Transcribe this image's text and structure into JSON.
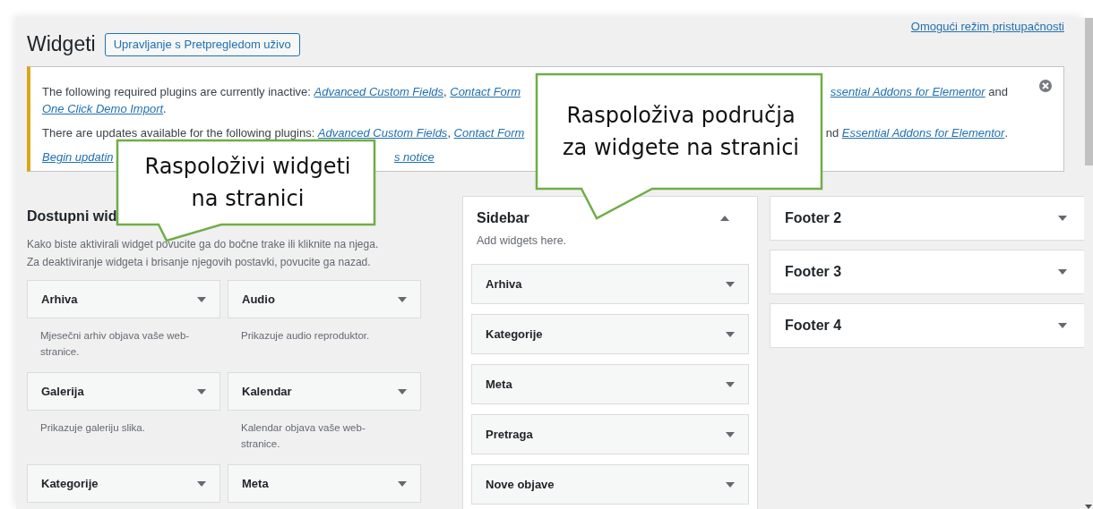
{
  "page": {
    "title": "Widgeti",
    "live_preview_button": "Upravljanje s Pretpregledom uživo",
    "accessibility_link": "Omogući režim pristupačnosti"
  },
  "notice": {
    "lines": [
      {
        "before": [
          {
            "text": "The following required plugins are currently inactive: ",
            "link": false
          },
          {
            "text": "Advanced Custom Fields",
            "link": true
          },
          {
            "text": ", ",
            "link": false
          },
          {
            "text": "Contact Form",
            "link": true
          }
        ],
        "after": [
          {
            "text": "ssential Addons for Elementor",
            "link": true
          },
          {
            "text": " and",
            "link": false
          }
        ]
      },
      {
        "before": [
          {
            "text": "One Click Demo Import",
            "link": true
          },
          {
            "text": ".",
            "link": false
          }
        ]
      },
      {
        "before": [
          {
            "text": "There are updates available for the following plugins: ",
            "link": false
          },
          {
            "text": "Advanced Custom Fields",
            "link": true
          },
          {
            "text": ", ",
            "link": false
          },
          {
            "text": "Contact Form",
            "link": true
          }
        ],
        "after": [
          {
            "text": "nd ",
            "link": false
          },
          {
            "text": "Essential Addons for Elementor",
            "link": true
          },
          {
            "text": ".",
            "link": false
          }
        ]
      },
      {
        "before": [
          {
            "text": "Begin updatin",
            "link": true
          }
        ],
        "after": [
          {
            "text": "s notice",
            "link": true
          }
        ]
      }
    ]
  },
  "available": {
    "heading": "Dostupni wid",
    "description": [
      "Kako biste aktivirali widget povucite ga do bočne trake ili kliknite na njega.",
      "Za deaktiviranje widgeta i brisanje njegovih postavki, povucite ga nazad."
    ],
    "widgets": [
      {
        "name": "Arhiva",
        "description": "Mjesečni arhiv objava vaše web-stranice."
      },
      {
        "name": "Audio",
        "description": "Prikazuje audio reproduktor."
      },
      {
        "name": "Galerija",
        "description": "Prikazuje galeriju slika."
      },
      {
        "name": "Kalendar",
        "description": "Kalendar objava vaše web-stranice."
      },
      {
        "name": "Kategorije"
      },
      {
        "name": "Meta"
      }
    ]
  },
  "sidebars": [
    {
      "name": "Sidebar",
      "expanded": true,
      "description": "Add widgets here.",
      "widgets": [
        "Arhiva",
        "Kategorije",
        "Meta",
        "Pretraga",
        "Nove objave"
      ]
    },
    {
      "name": "Footer 2",
      "expanded": false
    },
    {
      "name": "Footer 3",
      "expanded": false
    },
    {
      "name": "Footer 4",
      "expanded": false
    }
  ],
  "callouts": [
    {
      "lines": [
        "Raspoloživi widgeti",
        "na stranici"
      ]
    },
    {
      "lines": [
        "Raspoloživa područja",
        "za widgete na stranici"
      ]
    }
  ]
}
